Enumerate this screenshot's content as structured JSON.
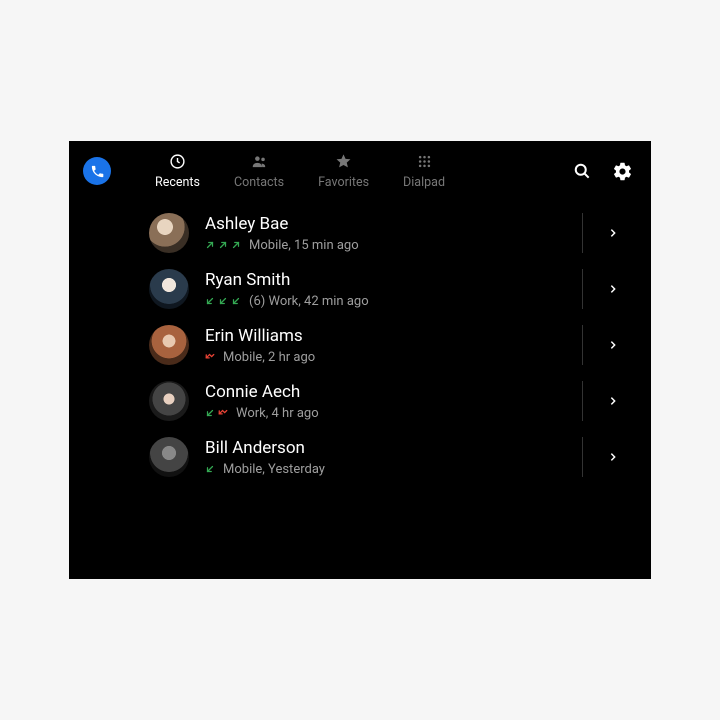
{
  "tabs": [
    {
      "label": "Recents",
      "active": true
    },
    {
      "label": "Contacts",
      "active": false
    },
    {
      "label": "Favorites",
      "active": false
    },
    {
      "label": "Dialpad",
      "active": false
    }
  ],
  "calls": [
    {
      "name": "Ashley Bae",
      "calls": [
        {
          "type": "outgoing"
        },
        {
          "type": "outgoing"
        },
        {
          "type": "outgoing"
        }
      ],
      "count_prefix": "",
      "line": "Mobile",
      "when": "15 min ago"
    },
    {
      "name": "Ryan Smith",
      "calls": [
        {
          "type": "incoming"
        },
        {
          "type": "incoming"
        },
        {
          "type": "incoming"
        }
      ],
      "count_prefix": "(6) ",
      "line": "Work",
      "when": "42 min ago"
    },
    {
      "name": "Erin Williams",
      "calls": [
        {
          "type": "missed"
        }
      ],
      "count_prefix": "",
      "line": "Mobile",
      "when": "2 hr ago"
    },
    {
      "name": "Connie Aech",
      "calls": [
        {
          "type": "incoming"
        },
        {
          "type": "missed"
        }
      ],
      "count_prefix": "",
      "line": "Work",
      "when": "4 hr ago"
    },
    {
      "name": "Bill Anderson",
      "calls": [
        {
          "type": "incoming"
        }
      ],
      "count_prefix": "",
      "line": "Mobile",
      "when": "Yesterday"
    }
  ],
  "colors": {
    "call_green": "#34a853",
    "call_missed": "#ea4335"
  }
}
